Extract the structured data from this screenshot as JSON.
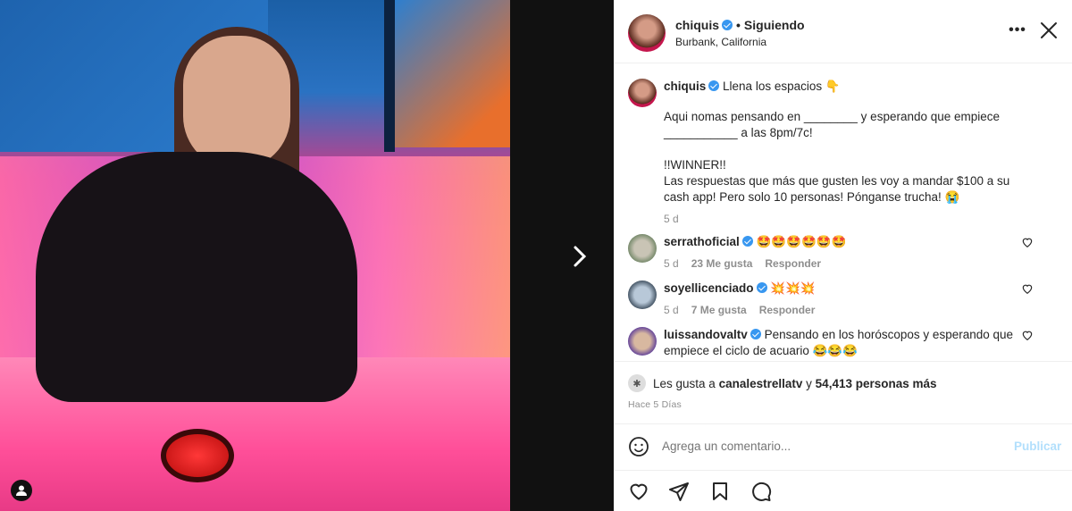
{
  "post": {
    "username": "chiquis",
    "following_label": "Siguiendo",
    "location": "Burbank, California",
    "caption_title": "Llena los espacios 👇",
    "caption_body": "Aqui nomas pensando en ________ y esperando que empiece ___________ a las 8pm/7c!\n\n!!WINNER!!\nLas respuestas que más que gusten les voy a mandar $100 a su cash app! Pero solo 10 personas! Pónganse trucha! 😭",
    "caption_time": "5 d"
  },
  "comments": [
    {
      "username": "serrathoficial",
      "text": "🤩🤩🤩🤩🤩🤩",
      "time": "5 d",
      "likes": "23 Me gusta",
      "reply": "Responder"
    },
    {
      "username": "soyellicenciado",
      "text": "💥💥💥",
      "time": "5 d",
      "likes": "7 Me gusta",
      "reply": "Responder"
    },
    {
      "username": "luissandovaltv",
      "text": "Pensando en los horóscopos y esperando que empiece el ciclo de acuario 😂😂😂"
    }
  ],
  "likes": {
    "prefix": "Les gusta a",
    "user": "canalestrellatv",
    "joiner": "y",
    "others": "54,413 personas más"
  },
  "posted_time": "Hace 5 Días",
  "comment_box": {
    "placeholder": "Agrega un comentario...",
    "post_label": "Publicar"
  },
  "colors": {
    "verified": "#3897f0",
    "post_disabled": "#b2dffc"
  }
}
